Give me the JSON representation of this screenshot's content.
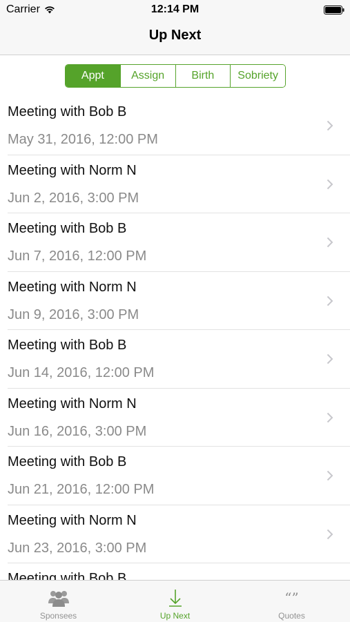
{
  "status_bar": {
    "carrier": "Carrier",
    "time": "12:14 PM",
    "icons": [
      "wifi-icon",
      "battery-icon"
    ]
  },
  "nav": {
    "title": "Up Next"
  },
  "segments": [
    {
      "label": "Appt",
      "selected": true
    },
    {
      "label": "Assign",
      "selected": false
    },
    {
      "label": "Birth",
      "selected": false
    },
    {
      "label": "Sobriety",
      "selected": false
    }
  ],
  "appointments": [
    {
      "title": "Meeting with Bob B",
      "date": "May 31, 2016, 12:00 PM"
    },
    {
      "title": "Meeting with Norm N",
      "date": "Jun 2, 2016, 3:00 PM"
    },
    {
      "title": "Meeting with Bob B",
      "date": "Jun 7, 2016, 12:00 PM"
    },
    {
      "title": "Meeting with Norm N",
      "date": "Jun 9, 2016, 3:00 PM"
    },
    {
      "title": "Meeting with Bob B",
      "date": "Jun 14, 2016, 12:00 PM"
    },
    {
      "title": "Meeting with Norm N",
      "date": "Jun 16, 2016, 3:00 PM"
    },
    {
      "title": "Meeting with Bob B",
      "date": "Jun 21, 2016, 12:00 PM"
    },
    {
      "title": "Meeting with Norm N",
      "date": "Jun 23, 2016, 3:00 PM"
    },
    {
      "title": "Meeting with Bob B",
      "date": ""
    }
  ],
  "tabs": [
    {
      "label": "Sponsees",
      "icon": "people-icon",
      "selected": false
    },
    {
      "label": "Up Next",
      "icon": "down-arrow-icon",
      "selected": true
    },
    {
      "label": "Quotes",
      "icon": "quote-icon",
      "selected": false
    }
  ],
  "colors": {
    "accent": "#55a32a",
    "secondary_text": "#8a8a8a",
    "bar_background": "#f7f7f7"
  }
}
